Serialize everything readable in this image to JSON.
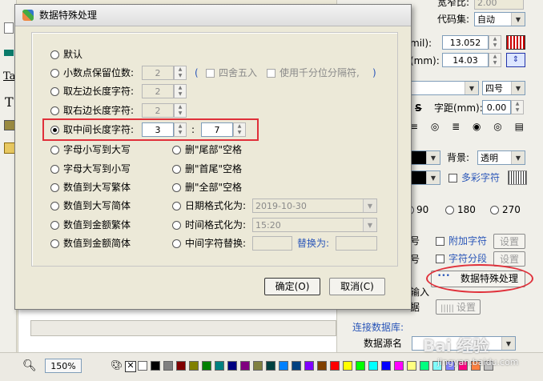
{
  "right_panel": {
    "ratio_label": "宽窄比:",
    "ratio_value": "2.00",
    "codeset_label": "代码集:",
    "codeset_value": "自动",
    "mil_label": "mil):",
    "mil_value": "13.052",
    "mm_label": "(mm):",
    "mm_value": "14.03",
    "font_size_value": "四号",
    "char_spacing_label": "字距(mm):",
    "char_spacing_value": "0.00",
    "background_label": "背景:",
    "background_value": "透明",
    "multicolor_label": "多彩字符",
    "rotation_options": [
      "90",
      "180",
      "270"
    ],
    "append_char_label": "附加字符",
    "append_settings": "设置",
    "char_segment_label": "字符分段",
    "segment_settings": "设置",
    "special_button": "数据特殊处理",
    "input_fragment": "输入",
    "data_fragment": "据",
    "barcode_settings": "设置",
    "connect_db_label": "连接数据库:",
    "data_source_label": "数据源名",
    "right_fragment_1": "号",
    "right_fragment_2": "号"
  },
  "statusbar": {
    "zoom": "150%"
  },
  "palette_colors": [
    "#ffffff",
    "#000000",
    "#808080",
    "#800000",
    "#808000",
    "#008000",
    "#008080",
    "#000080",
    "#800080",
    "#808040",
    "#004040",
    "#0080ff",
    "#004080",
    "#8000ff",
    "#804000",
    "#ff0000",
    "#ffff00",
    "#00ff00",
    "#00ffff",
    "#0000ff",
    "#ff00ff",
    "#ffff80",
    "#00ff80",
    "#80ffff",
    "#8080ff",
    "#ff0080",
    "#ff8040",
    "#c0c0c0"
  ],
  "dialog": {
    "title": "数据特殊处理",
    "close_label": "✕",
    "options": {
      "default": "默认",
      "decimal": "小数点保留位数:",
      "decimal_value": "2",
      "round_label": "四舍五入",
      "thousands_label": "使用千分位分隔符,",
      "paren_open": "(",
      "paren_close": ")",
      "left_chars": "取左边长度字符:",
      "left_value": "2",
      "right_chars": "取右边长度字符:",
      "right_value": "2",
      "mid_chars": "取中间长度字符:",
      "mid_start": "3",
      "mid_sep": ":",
      "mid_length": "7",
      "lower_to_upper": "字母小写到大写",
      "upper_to_lower": "字母大写到小写",
      "num_big_trad": "数值到大写繁体",
      "num_big_simp": "数值到大写简体",
      "num_amount_trad": "数值到金额繁体",
      "num_amount_simp": "数值到金额简体",
      "del_tail": "删\"尾部\"空格",
      "del_head": "删\"首尾\"空格",
      "del_all": "删\"全部\"空格",
      "date_format": "日期格式化为:",
      "date_value": "2019-10-30",
      "time_format": "时间格式化为:",
      "time_value": "15:20",
      "mid_replace": "中间字符替换:",
      "replace_with": "替换为:"
    },
    "ok_button": "确定(O)",
    "cancel_button": "取消(C)"
  },
  "watermark": "Bai 经验",
  "watermark_url": "jingyan.baidu.com",
  "colors": {
    "highlight_red": "#e0303a",
    "accent_blue": "#2a56b8"
  }
}
